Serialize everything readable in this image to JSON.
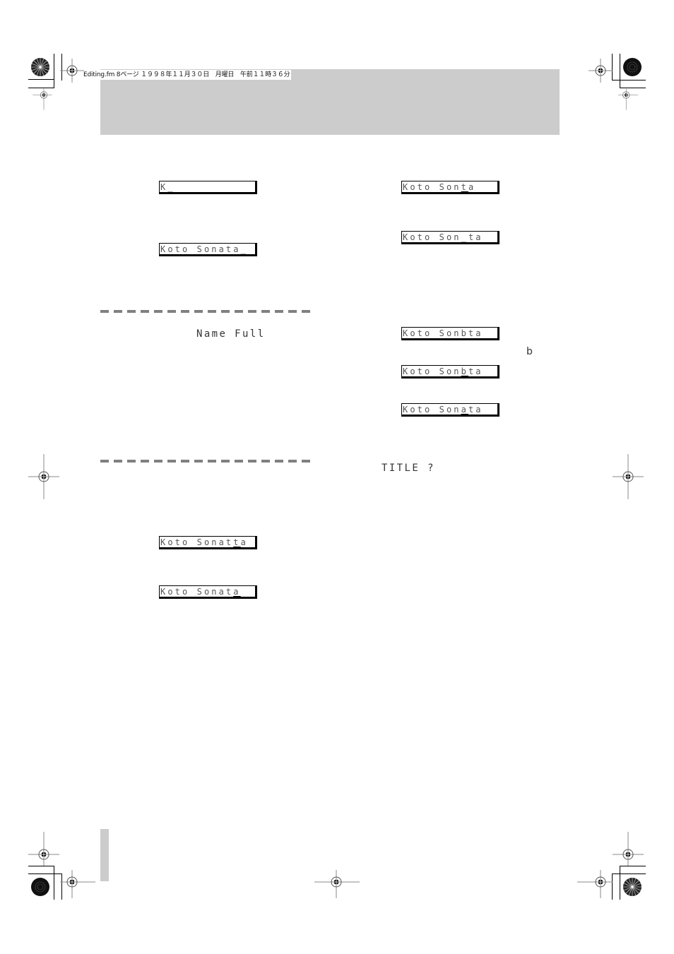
{
  "header": {
    "meta_text": "Editing.fm 8ページ １９９８年１１月３０日　月曜日　午前１１時３６分"
  },
  "left_column": {
    "lcd_1": {
      "before": "K",
      "cursor": "_",
      "after": ""
    },
    "lcd_2": {
      "before": "Koto Sonata",
      "cursor": "_",
      "after": ""
    },
    "name_full_label": "Name Full",
    "lcd_3": {
      "before": "Koto Sonat",
      "cursor": "t",
      "after": "a"
    },
    "lcd_4": {
      "before": "Koto Sonat",
      "cursor": "a",
      "after": ""
    }
  },
  "right_column": {
    "lcd_1": {
      "before": "Koto Son",
      "cursor": "t",
      "after": "a"
    },
    "lcd_2": {
      "before": "Koto Son",
      "cursor": "_",
      "after": "ta"
    },
    "lcd_3": {
      "before": "Koto Sonbta",
      "cursor": "",
      "after": ""
    },
    "b_glyph": "b",
    "lcd_4": {
      "before": "Koto Son",
      "cursor": "b",
      "after": "ta"
    },
    "lcd_5": {
      "before": "Koto Son",
      "cursor": "a",
      "after": "ta"
    },
    "title_prompt": "TITLE ?"
  },
  "icons": {
    "registration_mark": "crosshair-circle",
    "starburst_target": "radial-starburst",
    "solid_target": "solid-disc"
  },
  "colors": {
    "header_band": "#cccccc",
    "dash_rule": "#808080",
    "lcd_text": "#555555"
  }
}
